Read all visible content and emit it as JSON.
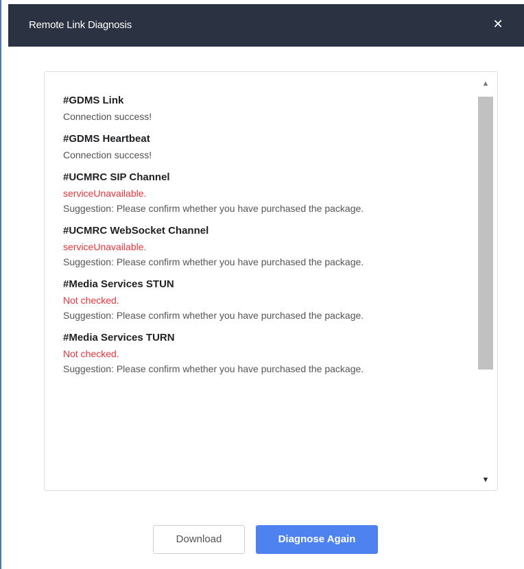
{
  "dialog": {
    "title": "Remote Link Diagnosis",
    "close_icon": "close-icon",
    "close_glyph": "✕"
  },
  "results": [
    {
      "title": "#GDMS Link",
      "status": "Connection success!",
      "status_type": "ok",
      "suggestion": ""
    },
    {
      "title": "#GDMS Heartbeat",
      "status": "Connection success!",
      "status_type": "ok",
      "suggestion": ""
    },
    {
      "title": "#UCMRC SIP Channel",
      "status": "serviceUnavailable.",
      "status_type": "error",
      "suggestion": "Suggestion: Please confirm whether you have purchased the package."
    },
    {
      "title": "#UCMRC WebSocket Channel",
      "status": "serviceUnavailable.",
      "status_type": "error",
      "suggestion": "Suggestion: Please confirm whether you have purchased the package."
    },
    {
      "title": "#Media Services STUN",
      "status": "Not checked.",
      "status_type": "error",
      "suggestion": "Suggestion: Please confirm whether you have purchased the package."
    },
    {
      "title": "#Media Services TURN",
      "status": "Not checked.",
      "status_type": "error",
      "suggestion": "Suggestion: Please confirm whether you have purchased the package."
    }
  ],
  "scrollbar": {
    "up_icon": "scroll-up-arrow-icon",
    "down_icon": "scroll-down-arrow-icon",
    "up_glyph": "▲",
    "down_glyph": "▼"
  },
  "buttons": {
    "download_label": "Download",
    "diagnose_label": "Diagnose Again"
  },
  "colors": {
    "titlebar": "#2b3241",
    "error": "#e8343c",
    "primary": "#4d82f0"
  }
}
